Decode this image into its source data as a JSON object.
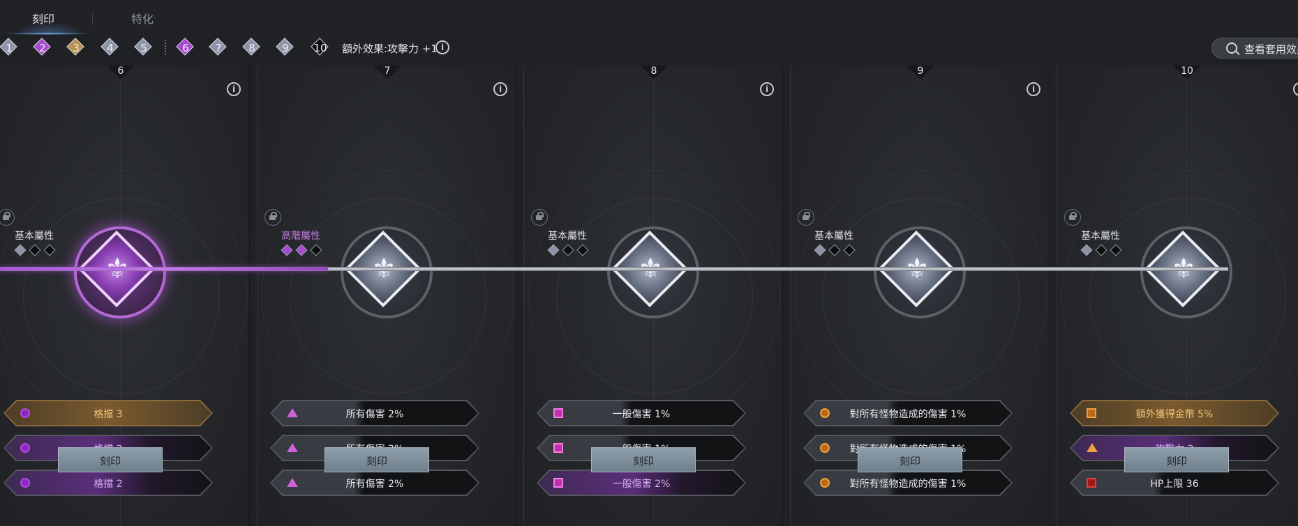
{
  "tabs": [
    {
      "label": "刻印",
      "active": true
    },
    {
      "label": "特化",
      "active": false
    }
  ],
  "steps": [
    {
      "label": "1",
      "color": "#8d94a8"
    },
    {
      "label": "2",
      "color": "#a64ad0"
    },
    {
      "label": "3",
      "color": "#b89050"
    },
    {
      "label": "4",
      "color": "#8d94a8"
    },
    {
      "label": "5",
      "color": "#8d94a8"
    },
    {
      "label": "6",
      "color": "#a64ad0"
    },
    {
      "label": "7",
      "color": "#8d94a8"
    },
    {
      "label": "8",
      "color": "#8d94a8"
    },
    {
      "label": "9",
      "color": "#8d94a8"
    },
    {
      "label": "10",
      "color": "#0d0e10"
    }
  ],
  "bonus_text": "額外效果:攻擊力 +1",
  "search_label": "查看套用效果",
  "info_glyph": "i",
  "emblem_glyph": "⚜",
  "panels": [
    {
      "number": "6",
      "tier": "基本屬性",
      "tier_color": "#e2e4e8",
      "pips": [
        "on",
        "off",
        "off"
      ],
      "emblem": "purple",
      "stats": [
        {
          "icon": "circle",
          "text": "格擋 3",
          "style": "gold"
        },
        {
          "icon": "circle",
          "text": "格擋 2",
          "style": "purp"
        },
        {
          "icon": "circle",
          "text": "格擋 2",
          "style": "purp"
        }
      ],
      "button": "刻印"
    },
    {
      "number": "7",
      "tier": "高階屬性",
      "tier_color": "#c87de8",
      "pips": [
        "purple",
        "purple",
        "off"
      ],
      "emblem": "silver",
      "stats": [
        {
          "icon": "tri",
          "text": "所有傷害 2%",
          "style": "normal"
        },
        {
          "icon": "tri",
          "text": "所有傷害 2%",
          "style": "normal"
        },
        {
          "icon": "tri",
          "text": "所有傷害 2%",
          "style": "normal"
        }
      ],
      "button": "刻印"
    },
    {
      "number": "8",
      "tier": "基本屬性",
      "tier_color": "#e2e4e8",
      "pips": [
        "on",
        "off",
        "off"
      ],
      "emblem": "silver",
      "stats": [
        {
          "icon": "sq",
          "text": "一般傷害 1%",
          "style": "normal"
        },
        {
          "icon": "sq",
          "text": "一般傷害 1%",
          "style": "normal"
        },
        {
          "icon": "sq",
          "text": "一般傷害 2%",
          "style": "purp"
        }
      ],
      "button": "刻印"
    },
    {
      "number": "9",
      "tier": "基本屬性",
      "tier_color": "#e2e4e8",
      "pips": [
        "on",
        "off",
        "off"
      ],
      "emblem": "silver",
      "stats": [
        {
          "icon": "circle-orange",
          "text": "對所有怪物造成的傷害 1%",
          "style": "normal"
        },
        {
          "icon": "circle-orange",
          "text": "對所有怪物造成的傷害 1%",
          "style": "normal"
        },
        {
          "icon": "circle-orange",
          "text": "對所有怪物造成的傷害 1%",
          "style": "normal"
        }
      ],
      "button": "刻印"
    },
    {
      "number": "10",
      "tier": "基本屬性",
      "tier_color": "#e2e4e8",
      "pips": [
        "on",
        "off",
        "off"
      ],
      "emblem": "silver",
      "stats": [
        {
          "icon": "sq-orange",
          "text": "額外獲得金幣 5%",
          "style": "gold"
        },
        {
          "icon": "tri-orange",
          "text": "攻擊力 2",
          "style": "purp"
        },
        {
          "icon": "sq-red",
          "text": "HP上限 36",
          "style": "normal"
        }
      ],
      "button": "刻印"
    }
  ]
}
